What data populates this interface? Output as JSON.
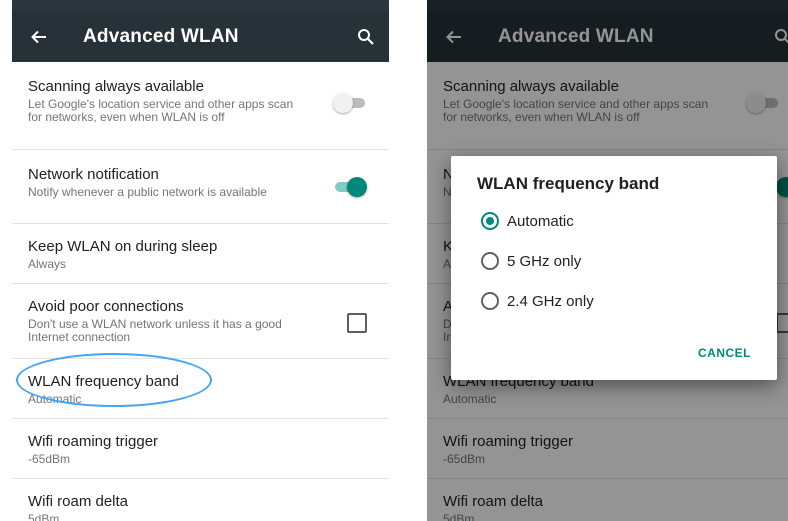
{
  "app": {
    "title": "Advanced WLAN",
    "icons": {
      "back": "back-arrow-icon",
      "search": "search-icon"
    }
  },
  "settings": [
    {
      "title": "Scanning always available",
      "summary": "Let Google's location service and other apps scan for networks, even when WLAN is off",
      "control": "toggle",
      "checked": false
    },
    {
      "title": "Network notification",
      "summary": "Notify whenever a public network is available",
      "control": "toggle",
      "checked": true
    },
    {
      "title": "Keep WLAN on during sleep",
      "summary": "Always",
      "control": "none"
    },
    {
      "title": "Avoid poor connections",
      "summary": "Don't use a WLAN network unless it has a good Internet connection",
      "control": "checkbox",
      "checked": false
    },
    {
      "title": "WLAN frequency band",
      "summary": "Automatic",
      "control": "none"
    },
    {
      "title": "Wifi roaming trigger",
      "summary": "-65dBm",
      "control": "none"
    },
    {
      "title": "Wifi roam delta",
      "summary": "5dBm",
      "control": "none"
    }
  ],
  "dialog": {
    "title": "WLAN frequency band",
    "options": [
      {
        "label": "Automatic",
        "selected": true
      },
      {
        "label": "5 GHz only",
        "selected": false
      },
      {
        "label": "2.4 GHz only",
        "selected": false
      }
    ],
    "cancel_label": "CANCEL"
  },
  "colors": {
    "appbar": "#263238",
    "accent": "#00897b",
    "annotation": "#42a5f5"
  }
}
